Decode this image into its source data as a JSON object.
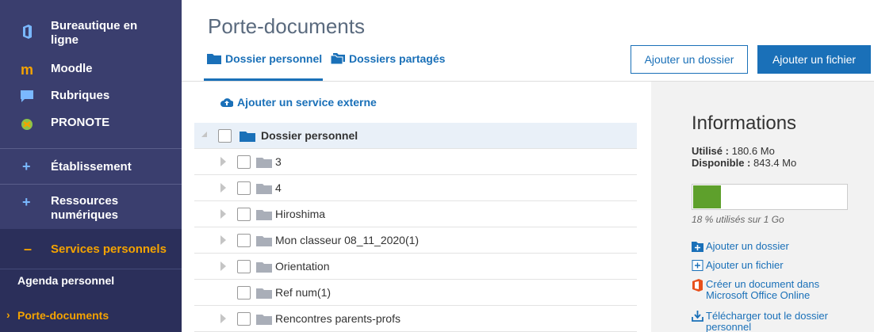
{
  "sidebar": {
    "items": [
      {
        "label": "Bureautique en ligne",
        "icon": "office-icon"
      },
      {
        "label": "Moodle",
        "icon": "moodle-icon"
      },
      {
        "label": "Rubriques",
        "icon": "chat-icon"
      },
      {
        "label": "PRONOTE",
        "icon": "pronote-icon"
      }
    ],
    "sections": [
      {
        "label": "Établissement",
        "toggle": "+"
      },
      {
        "label": "Ressources numériques",
        "toggle": "+"
      },
      {
        "label": "Services personnels",
        "toggle": "–"
      }
    ],
    "subitems": [
      {
        "label": "Agenda personnel"
      },
      {
        "label": "Porte-documents",
        "marker": "›"
      }
    ]
  },
  "main": {
    "title": "Porte-documents",
    "tabs": [
      {
        "label": "Dossier personnel",
        "active": true
      },
      {
        "label": "Dossiers partagés",
        "active": false
      }
    ],
    "buttons": {
      "add_folder": "Ajouter un dossier",
      "add_file": "Ajouter un fichier"
    },
    "external_service": "Ajouter un service externe",
    "tree": {
      "root": "Dossier personnel",
      "rows": [
        {
          "label": "3",
          "expandable": true
        },
        {
          "label": "4",
          "expandable": true
        },
        {
          "label": "Hiroshima",
          "expandable": true
        },
        {
          "label": "Mon classeur 08_11_2020(1)",
          "expandable": true
        },
        {
          "label": "Orientation",
          "expandable": true
        },
        {
          "label": "Ref num(1)",
          "expandable": false
        },
        {
          "label": "Rencontres parents-profs",
          "expandable": true
        }
      ]
    }
  },
  "info": {
    "title": "Informations",
    "used_label": "Utilisé :",
    "used_value": "180.6 Mo",
    "available_label": "Disponible :",
    "available_value": "843.4 Mo",
    "usage_fraction": 0.18,
    "usage_caption": "18 % utilisés sur 1 Go",
    "links": [
      {
        "label": "Ajouter un dossier",
        "icon": "add-folder-icon"
      },
      {
        "label": "Ajouter un fichier",
        "icon": "add-file-icon"
      },
      {
        "label": "Créer un document dans Microsoft Office Online",
        "icon": "office-icon"
      },
      {
        "label": "Télécharger tout le dossier personnel",
        "icon": "download-icon"
      }
    ]
  },
  "colors": {
    "sidebar": "#3a3e6e",
    "accent": "#1a70b8",
    "active_section": "#f4a300",
    "bar_fill": "#5ea02c"
  }
}
